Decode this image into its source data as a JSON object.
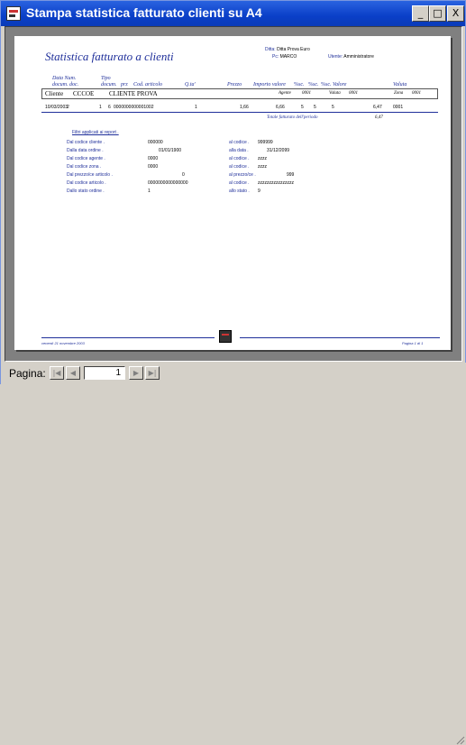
{
  "window": {
    "title": "Stampa statistica fatturato clienti su A4"
  },
  "titlebar_buttons": {
    "minimize": "_",
    "restore": "□",
    "close": "X"
  },
  "report": {
    "title": "Statistica fatturato a clienti",
    "meta": {
      "ditta_label": "Ditta:",
      "ditta_value": "Ditta Prova Euro",
      "pc_label": "Pc:",
      "pc_value": "MARCO",
      "utente_label": "Utente:",
      "utente_value": "Amministratore"
    },
    "columns": [
      "Data  Num.",
      "Tipo",
      "prz",
      "Cod. articolo",
      "Q.ta'",
      "Prezzo",
      "Importo valore",
      "%sc.",
      "%sc.",
      "%sc. Valore",
      "Valuta"
    ],
    "columns_row2": [
      "docum.  doc.",
      "docum."
    ],
    "cliente": {
      "label": "Cliente",
      "code": "CCCOE",
      "name": "CLIENTE PROVA",
      "agente_label": "Agente",
      "agente_value": "0001",
      "valuta_label": "Valuta",
      "valuta_value": "0001",
      "zona_label": "Zona",
      "zona_value": "0001"
    },
    "line": {
      "date": "10/03/2003",
      "num": "2",
      "tipo": "1",
      "prz": "6",
      "articolo": "0000000000001002",
      "qta": "1",
      "prezzo": "1,66",
      "importo": "6,66",
      "sc1": "5",
      "sc2": "5",
      "sc3": "5",
      "valore": "6,47",
      "valuta": "0001"
    },
    "total": {
      "label": "Totale fatturato dell'periodo",
      "value": "6,47"
    },
    "filter_title": "Filtri applicati ai report .",
    "filters": [
      {
        "label": "Dal codice cliente .",
        "value": "000000",
        "label2": "al codice .",
        "value2": "999999"
      },
      {
        "label": "Dalla data ordine .",
        "value": "01/01/1900",
        "label2": "alla data .",
        "value2": "31/12/2099"
      },
      {
        "label": "Dal codice agente .",
        "value": "0000",
        "label2": "al codice .",
        "value2": "zzzz"
      },
      {
        "label": "Dal codice zona .",
        "value": "0000",
        "label2": "al codice .",
        "value2": "zzzz"
      },
      {
        "label": "Dal prezzo/ce articolo .",
        "value": "0",
        "label2": "al prezzo/ce .",
        "value2": "999"
      },
      {
        "label": "Dal codice articolo .",
        "value": "0000000000000000",
        "label2": "al codice .",
        "value2": "zzzzzzzzzzzzzzzz"
      },
      {
        "label": "Dallo stato ordine .",
        "value": "1",
        "label2": "allo stato .",
        "value2": "9"
      }
    ],
    "footer_left": "venerdì 21 novembre 2003",
    "footer_right": "Pagina 1 di 1"
  },
  "statusbar": {
    "page_label": "Pagina:",
    "page_value": "1",
    "first": "|◀",
    "prev": "◀",
    "next": "▶",
    "last": "▶|"
  }
}
